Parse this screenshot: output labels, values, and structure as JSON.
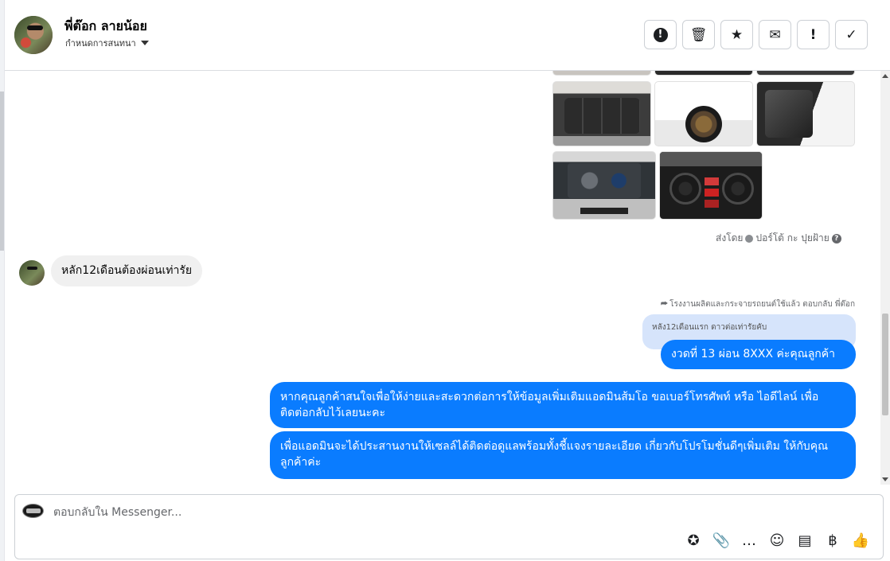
{
  "header": {
    "name": "พี่ต๊อก ลายน้อย",
    "subtitle": "กำหนดการสนทนา",
    "tools": [
      {
        "icon": "alert-circle-icon",
        "label": "!"
      },
      {
        "icon": "trash-icon",
        "label": "🗑"
      },
      {
        "icon": "star-icon",
        "label": "★"
      },
      {
        "icon": "mail-icon",
        "label": "✉"
      },
      {
        "icon": "exclamation-icon",
        "label": "!"
      },
      {
        "icon": "check-icon",
        "label": "✓"
      }
    ]
  },
  "conversation": {
    "sent_by_prefix": "ส่งโดย",
    "sent_by_name": "ปอร์โต้ กะ ปุยฝ้าย",
    "sent_by_help": "?",
    "incoming_message": "หลัก12เดือนต้องผ่อนเท่ารัย",
    "reply_label": "โรงงานผลิตและกระจายรถยนต์ใช้แล้ว ตอบกลับ พี่ต๊อก",
    "reply_arrow": "⮫",
    "quoted_text": "หลัง12เดือนแรก ดาวต่อเท่ารัยคับ",
    "outgoing": [
      "งวดที่ 13  ผ่อน 8XXX ค่ะคุณลูกค้า",
      "หากคุณลูกค้าสนใจเพื่อให้ง่ายและสะดวกต่อการให้ข้อมูลเพิ่มเติมแอดมินส้มโอ ขอเบอร์โทรศัพท์ หรือ ไอดีไลน์ เพื่อติดต่อกลับไว้เลยนะคะ",
      "เพื่อแอดมินจะได้ประสานงานให้เซลล์ได้ติดต่อดูแลพร้อมทั้งชี้แจงรายละเอียด เกี่ยวกับโปรโมชั่นดีๆเพิ่มเติม ให้กับคุณลูกค้าค่ะ"
    ]
  },
  "composer": {
    "placeholder": "ตอบกลับใน Messenger...",
    "tools": [
      {
        "icon": "quick-reply-icon",
        "label": "✪"
      },
      {
        "icon": "paperclip-icon",
        "label": "📎"
      },
      {
        "icon": "saved-reply-icon",
        "label": "…"
      },
      {
        "icon": "emoji-icon",
        "label": "☺"
      },
      {
        "icon": "notes-icon",
        "label": "▤"
      },
      {
        "icon": "baht-icon",
        "label": "฿"
      },
      {
        "icon": "thumbs-up-icon",
        "label": "👍"
      }
    ]
  },
  "colors": {
    "accent": "#0a7cff",
    "incoming_bubble": "#f0f0f0",
    "quote_bubble": "#d6e4fb"
  }
}
